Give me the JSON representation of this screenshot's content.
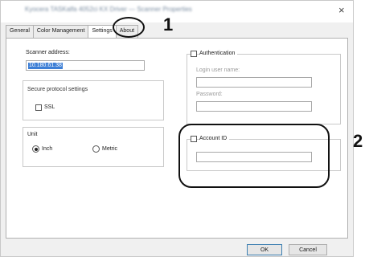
{
  "window": {
    "title": "Kyocera TASKalfa 4052ci KX Driver — Scanner Properties",
    "close_glyph": "×"
  },
  "tabs": [
    {
      "label": "General"
    },
    {
      "label": "Color Management"
    },
    {
      "label": "Settings"
    },
    {
      "label": "About"
    }
  ],
  "active_tab": "Settings",
  "scanner": {
    "address_label": "Scanner address:",
    "address_value": "10.180.61.38"
  },
  "secure_protocol": {
    "group_label": "Secure protocol settings",
    "ssl_label": "SSL",
    "ssl_checked": false
  },
  "unit": {
    "group_label": "Unit",
    "options": [
      {
        "label": "Inch",
        "selected": true
      },
      {
        "label": "Metric",
        "selected": false
      }
    ]
  },
  "authentication": {
    "label": "Authentication",
    "checked": false,
    "login_label": "Login user name:",
    "login_value": "",
    "password_label": "Password:",
    "password_value": ""
  },
  "account": {
    "label": "Account ID",
    "checked": false,
    "value": ""
  },
  "buttons": {
    "ok": "OK",
    "cancel": "Cancel"
  },
  "callouts": {
    "one": "1",
    "two": "2"
  },
  "colors": {
    "selection": "#3d7fd6",
    "dialog_bg": "#f0f0f0",
    "disabled_text": "#9a9a9a"
  }
}
